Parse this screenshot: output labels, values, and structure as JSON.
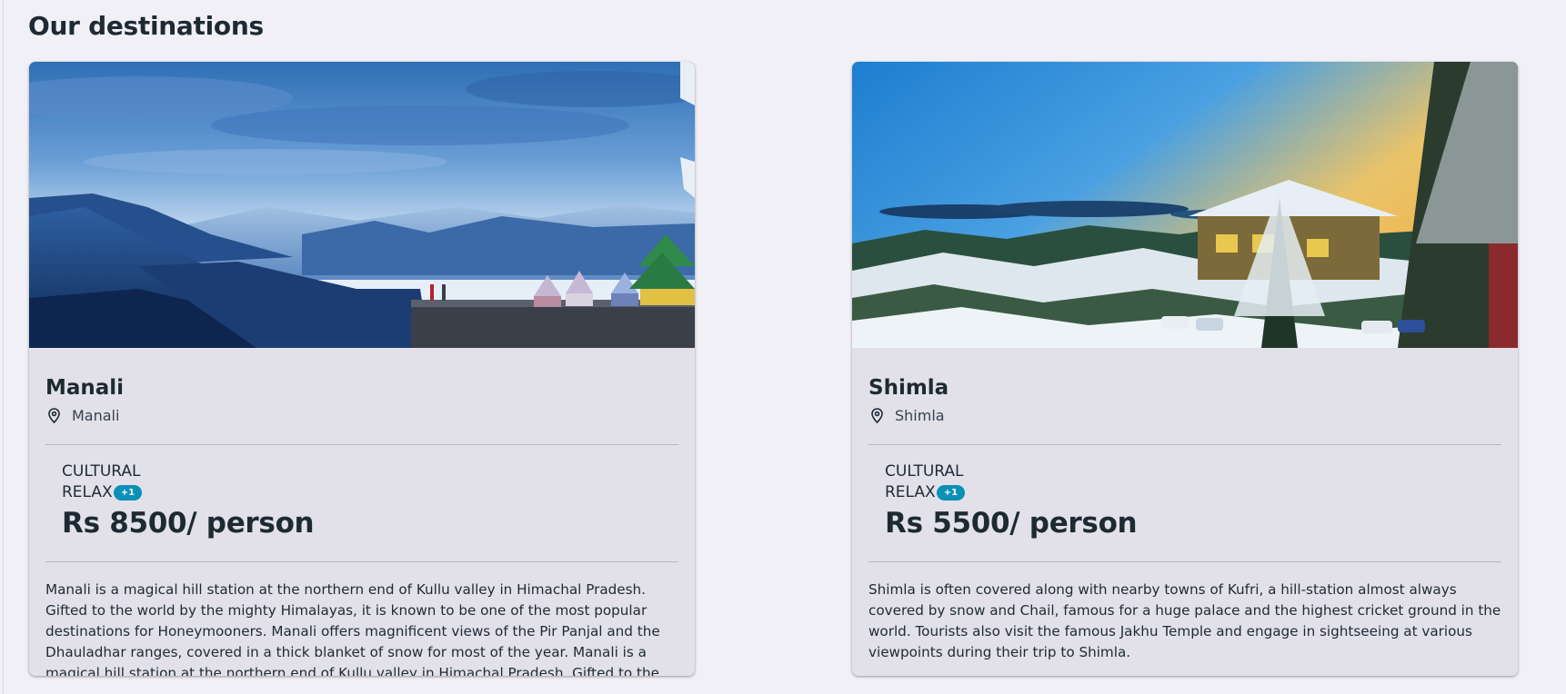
{
  "page": {
    "title": "Our destinations"
  },
  "destinations": [
    {
      "name": "Manali",
      "location": "Manali",
      "tags": [
        "CULTURAL",
        "RELAX"
      ],
      "extra_tags_badge": "+1",
      "price": "Rs 8500/ person",
      "description": "Manali is a magical hill station at the northern end of Kullu valley in Himachal Pradesh. Gifted to the world by the mighty Himalayas, it is known to be one of the most popular destinations for Honeymooners. Manali offers magnificent views of the Pir Panjal and the Dhauladhar ranges, covered in a thick blanket of snow for most of the year. Manali is a magical hill station at the northern end of Kullu valley in Himachal Pradesh. Gifted to the"
    },
    {
      "name": "Shimla",
      "location": "Shimla",
      "tags": [
        "CULTURAL",
        "RELAX"
      ],
      "extra_tags_badge": "+1",
      "price": "Rs 5500/ person",
      "description": "Shimla is often covered along with nearby towns of Kufri, a hill-station almost always covered by snow and Chail, famous for a huge palace and the highest cricket ground in the world. Tourists also visit the famous Jakhu Temple and engage in sightseeing at various viewpoints during their trip to Shimla."
    }
  ],
  "icons": {
    "location": "map-pin-icon"
  },
  "colors": {
    "badge": "#0b90b6",
    "card_background": "#e2e1ea",
    "page_background": "#f1f0f6"
  }
}
